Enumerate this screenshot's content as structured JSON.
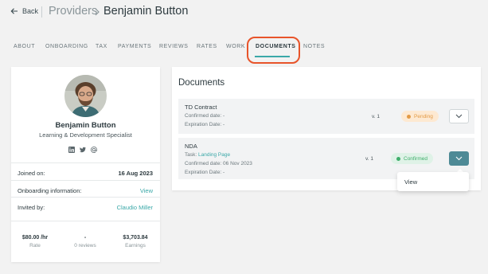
{
  "header": {
    "back_label": "Back",
    "breadcrumb_parent": "Providers",
    "breadcrumb_current": "Benjamin Button"
  },
  "tabs": [
    {
      "label": "ABOUT",
      "active": false
    },
    {
      "label": "ONBOARDING",
      "active": false
    },
    {
      "label": "TAX",
      "active": false
    },
    {
      "label": "PAYMENTS",
      "active": false
    },
    {
      "label": "REVIEWS",
      "active": false
    },
    {
      "label": "RATES",
      "active": false
    },
    {
      "label": "WORK",
      "active": false
    },
    {
      "label": "DOCUMENTS",
      "active": true
    },
    {
      "label": "NOTES",
      "active": false
    }
  ],
  "profile": {
    "name": "Benjamin Button",
    "title": "Learning & Development Specialist",
    "socials": [
      "linkedin-icon",
      "twitter-icon",
      "email-icon"
    ],
    "joined_label": "Joined on:",
    "joined_value": "16 Aug 2023",
    "onboarding_label": "Onboarding information:",
    "onboarding_value": "View",
    "invited_label": "Invited by:",
    "invited_value": "Claudio Miller",
    "stats": [
      {
        "value": "$80.00 /hr",
        "label": "Rate"
      },
      {
        "value": "-",
        "label": "0 reviews"
      },
      {
        "value": "$3,703.84",
        "label": "Earnings"
      }
    ]
  },
  "documents": {
    "title": "Documents",
    "items": [
      {
        "name": "TD Contract",
        "confirmed": "Confirmed date: -",
        "expiration": "Expiration Date: -",
        "version": "v. 1",
        "status": "Pending"
      },
      {
        "name": "NDA",
        "task_prefix": "Task:",
        "task_link": "Landing Page",
        "confirmed": "Confirmed date: 06 Nov 2023",
        "expiration": "Expiration Date: -",
        "version": "v. 1",
        "status": "Confirmed"
      }
    ],
    "menu": {
      "items": [
        "View"
      ]
    }
  },
  "colors": {
    "accent": "#3aa8a8",
    "highlight": "#e8542a",
    "pending": "#e39a45",
    "confirmed": "#3fae6b",
    "dropdown_filled": "#4e8a96"
  }
}
